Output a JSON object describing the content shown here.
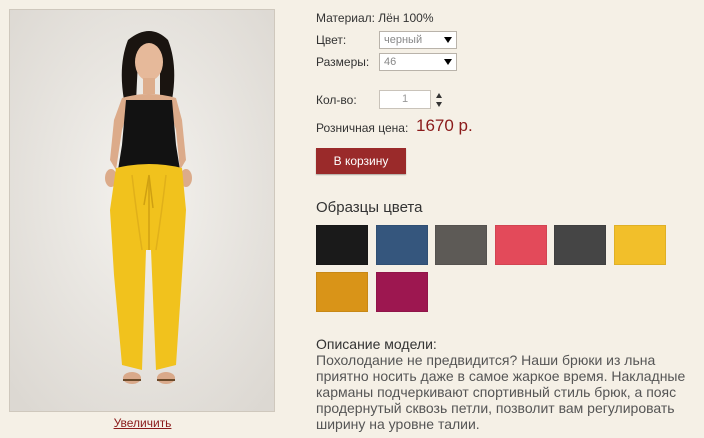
{
  "product": {
    "material": "Материал: Лён 100%",
    "color_label": "Цвет:",
    "color_value": "черный",
    "size_label": "Размеры:",
    "size_value": "46",
    "qty_label": "Кол-во:",
    "qty_value": "1",
    "price_label": "Розничная цена:",
    "price_value": "1670 р.",
    "cart_button": "В корзину",
    "zoom_link": "Увеличить"
  },
  "swatches": {
    "title": "Образцы цвета",
    "colors": [
      "#1a1a1a",
      "#35567d",
      "#5d5a56",
      "#e34a5a",
      "#454545",
      "#f2bf2a",
      "#d99418",
      "#9d1750"
    ]
  },
  "description": {
    "title": "Описание модели:",
    "text": "Похолодание не предвидится? Наши брюки из льна приятно носить даже в самое жаркое время. Накладные карманы подчеркивают спортивный стиль брюк, а пояс продернутый сквозь петли, позволит вам регулировать ширину на уровне талии."
  },
  "colors": {
    "accent": "#9a2a2a",
    "price": "#8b1a1a",
    "background": "#f5f0e6"
  }
}
